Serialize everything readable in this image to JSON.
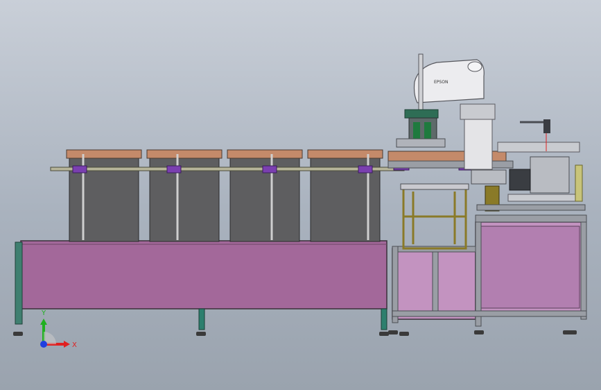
{
  "model": {
    "robot_label": "EPSON",
    "colors": {
      "frame_pink": "#a3689a",
      "frame_edge": "#3a2f3a",
      "bin_gray": "#5e5e60",
      "bin_lid": "#c48a6a",
      "clamp_purple": "#7a3fb0",
      "robot_white": "#e4e4e7",
      "leg_teal": "#2d7f6e",
      "steel": "#9a9ea5",
      "amber": "#8a7a28",
      "laser_red": "#e02020"
    }
  },
  "triad": {
    "x_label": "X",
    "y_label": "Y",
    "x_color": "#e02020",
    "y_color": "#20b020",
    "z_color": "#2040e0"
  }
}
